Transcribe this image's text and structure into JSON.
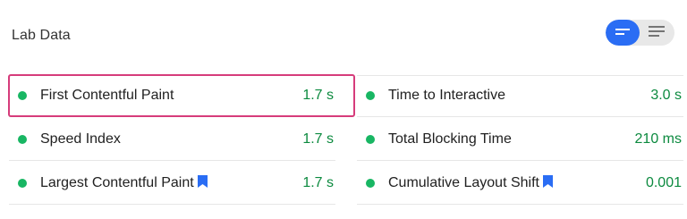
{
  "section": {
    "title": "Lab Data"
  },
  "view_toggle": {
    "active": "summary",
    "buttons": [
      {
        "icon": "short-lines-icon",
        "state": "active"
      },
      {
        "icon": "list-lines-icon",
        "state": "inactive"
      }
    ]
  },
  "colors": {
    "accent": "#2a6df4",
    "pass_dot": "#18b663",
    "pass_value": "#0c8a3f",
    "highlight_border": "#d63c7b"
  },
  "metrics": {
    "left": [
      {
        "label": "First Contentful Paint",
        "value": "1.7 s",
        "status": "pass",
        "bookmark": false,
        "highlighted": true
      },
      {
        "label": "Speed Index",
        "value": "1.7 s",
        "status": "pass",
        "bookmark": false,
        "highlighted": false
      },
      {
        "label": "Largest Contentful Paint",
        "value": "1.7 s",
        "status": "pass",
        "bookmark": true,
        "highlighted": false
      }
    ],
    "right": [
      {
        "label": "Time to Interactive",
        "value": "3.0 s",
        "status": "pass",
        "bookmark": false,
        "highlighted": false
      },
      {
        "label": "Total Blocking Time",
        "value": "210 ms",
        "status": "pass",
        "bookmark": false,
        "highlighted": false
      },
      {
        "label": "Cumulative Layout Shift",
        "value": "0.001",
        "status": "pass",
        "bookmark": true,
        "highlighted": false
      }
    ]
  }
}
